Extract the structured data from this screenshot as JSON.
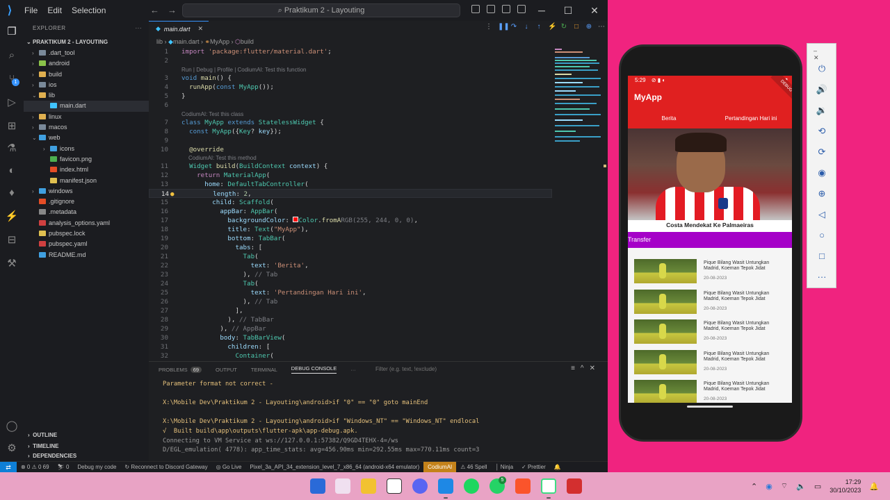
{
  "window": {
    "title": "Praktikum 2 - Layouting",
    "menu": [
      "File",
      "Edit",
      "Selection"
    ]
  },
  "explorer": {
    "header": "EXPLORER",
    "project": "PRAKTIKUM 2 - LAYOUTING",
    "items": [
      {
        "label": ".dart_tool",
        "type": "folder",
        "indent": 1,
        "color": "#7a8a9a"
      },
      {
        "label": "android",
        "type": "folder",
        "indent": 1,
        "color": "#8bc34a"
      },
      {
        "label": "build",
        "type": "folder",
        "indent": 1,
        "color": "#e0b050"
      },
      {
        "label": "ios",
        "type": "folder",
        "indent": 1,
        "color": "#7a8a9a"
      },
      {
        "label": "lib",
        "type": "folder-open",
        "indent": 1,
        "color": "#e0b050"
      },
      {
        "label": "main.dart",
        "type": "file",
        "indent": 2,
        "color": "#40c4ff",
        "selected": true
      },
      {
        "label": "linux",
        "type": "folder",
        "indent": 1,
        "color": "#e0b050"
      },
      {
        "label": "macos",
        "type": "folder",
        "indent": 1,
        "color": "#7a8a9a"
      },
      {
        "label": "web",
        "type": "folder-open",
        "indent": 1,
        "color": "#40a0e0"
      },
      {
        "label": "icons",
        "type": "folder",
        "indent": 2,
        "color": "#40a0e0"
      },
      {
        "label": "favicon.png",
        "type": "file",
        "indent": 2,
        "color": "#4caf50"
      },
      {
        "label": "index.html",
        "type": "file",
        "indent": 2,
        "color": "#e44d26"
      },
      {
        "label": "manifest.json",
        "type": "file",
        "indent": 2,
        "color": "#e0c050"
      },
      {
        "label": "windows",
        "type": "folder",
        "indent": 1,
        "color": "#40a0e0"
      },
      {
        "label": ".gitignore",
        "type": "file",
        "indent": 1,
        "color": "#e44d26"
      },
      {
        "label": ".metadata",
        "type": "file",
        "indent": 1,
        "color": "#888888"
      },
      {
        "label": "analysis_options.yaml",
        "type": "file",
        "indent": 1,
        "color": "#d04040"
      },
      {
        "label": "pubspec.lock",
        "type": "file",
        "indent": 1,
        "color": "#e0c050"
      },
      {
        "label": "pubspec.yaml",
        "type": "file",
        "indent": 1,
        "color": "#d04040"
      },
      {
        "label": "README.md",
        "type": "file",
        "indent": 1,
        "color": "#40a0e0"
      }
    ],
    "outline": "OUTLINE",
    "timeline": "TIMELINE",
    "dependencies": "DEPENDENCIES"
  },
  "editor": {
    "tab": "main.dart",
    "breadcrumb": [
      "lib",
      "main.dart",
      "MyApp",
      "build"
    ],
    "current_line": "14"
  },
  "panel": {
    "tabs": [
      "PROBLEMS",
      "OUTPUT",
      "TERMINAL",
      "DEBUG CONSOLE"
    ],
    "problems_count": "69",
    "filter_placeholder": "Filter (e.g. text, !exclude)",
    "lines": [
      {
        "text": "Parameter format not correct -",
        "cls": "c-y"
      },
      {
        "text": "",
        "cls": "c-w"
      },
      {
        "text": "X:\\Mobile Dev\\Praktikum 2 - Layouting\\android>if \"0\" == \"0\" goto mainEnd",
        "cls": "c-y"
      },
      {
        "text": "",
        "cls": "c-w"
      },
      {
        "text": "X:\\Mobile Dev\\Praktikum 2 - Layouting\\android>if \"Windows_NT\" == \"Windows_NT\" endlocal",
        "cls": "c-y"
      },
      {
        "text": "√  Built build\\app\\outputs\\flutter-apk\\app-debug.apk.",
        "cls": "c-y"
      },
      {
        "text": "Connecting to VM Service at ws://127.0.0.1:57382/Q9GD4TEHX-4=/ws",
        "cls": "c-d"
      },
      {
        "text": "D/EGL_emulation( 4778): app_time_stats: avg=456.90ms min=292.55ms max=770.11ms count=3",
        "cls": "c-d"
      }
    ]
  },
  "statusbar": {
    "problems": "⊗ 0 ⚠ 0 69",
    "ports": "⛷ 0",
    "debug": "Debug my code",
    "discord": "↻ Reconnect to Discord Gateway",
    "golive": "◎ Go Live",
    "device": "Pixel_3a_API_34_extension_level_7_x86_64 (android-x64 emulator)",
    "codium": "CodiumAI",
    "spell": "⚠ 46 Spell",
    "ninja": "│ Ninja",
    "prettier": "✓ Prettier"
  },
  "phone": {
    "time": "5:29",
    "app_title": "MyApp",
    "tabs": [
      "Berita",
      "Pertandingan Hari ini"
    ],
    "hero_caption": "Costa Mendekat Ke Palmaeiras",
    "section": "Transfer",
    "debug_banner": "DEBUG",
    "news": [
      {
        "title": "Pique Bilang Wasit Untungkan Madrid, Koeman Tepok Jidat",
        "date": "20-08-2023"
      },
      {
        "title": "Pique Bilang Wasit Untungkan Madrid, Koeman Tepok Jidat",
        "date": "20-08-2023"
      },
      {
        "title": "Pique Bilang Wasit Untungkan Madrid, Koeman Tepok Jidat",
        "date": "20-08-2023"
      },
      {
        "title": "Pique Bilang Wasit Untungkan Madrid, Koeman Tepok Jidat",
        "date": "20-08-2023"
      },
      {
        "title": "Pique Bilang Wasit Untungkan Madrid, Koeman Tepok Jidat",
        "date": "20-08-2023"
      }
    ]
  },
  "emulator_toolbar": [
    "power-icon",
    "volume-up-icon",
    "volume-down-icon",
    "rotate-left-icon",
    "rotate-right-icon",
    "camera-icon",
    "zoom-icon",
    "back-icon",
    "home-icon",
    "overview-icon",
    "more-icon"
  ],
  "taskbar": {
    "time": "17:29",
    "date": "30/10/2023",
    "notification_badge": "5"
  }
}
